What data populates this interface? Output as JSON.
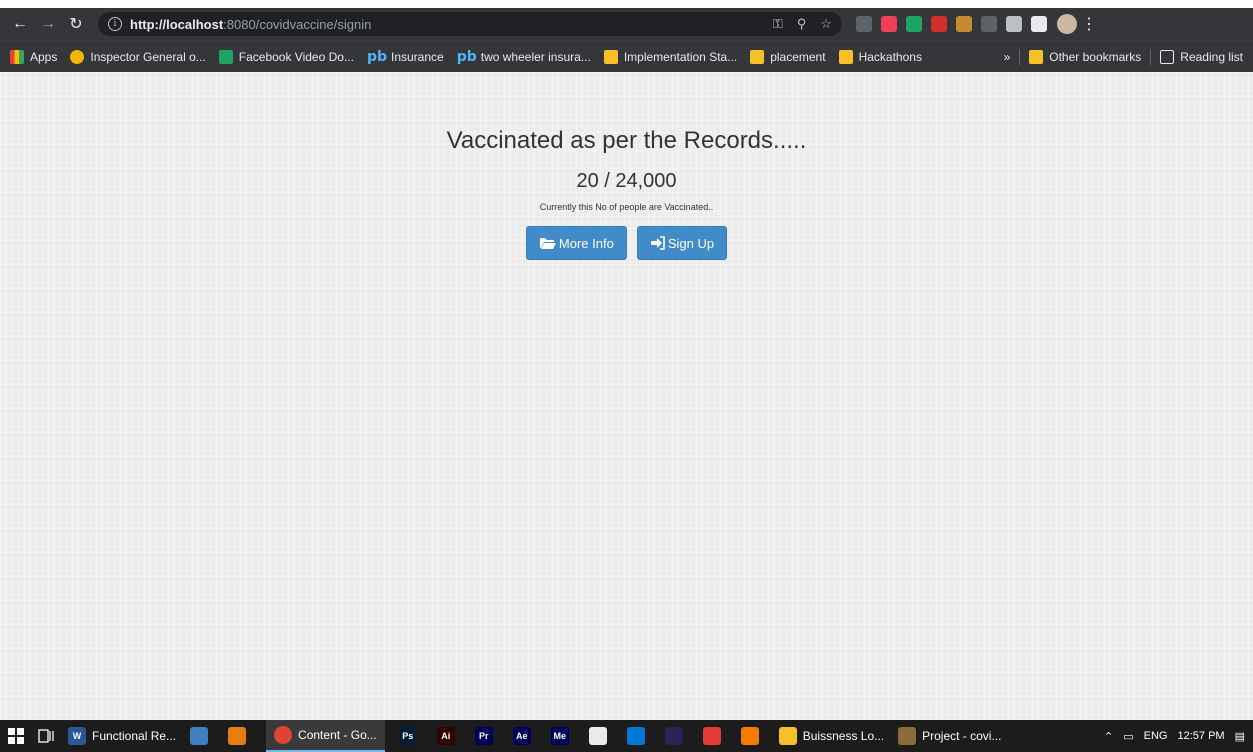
{
  "browser": {
    "url_host": "http://localhost",
    "url_rest": ":8080/covidvaccine/signin",
    "omni_icons": [
      "key-icon",
      "zoom-icon",
      "star-icon"
    ],
    "extensions": [
      {
        "name": "camera-extension-icon",
        "color": "#5f6368"
      },
      {
        "name": "pocket-extension-icon",
        "color": "#ef3f56"
      },
      {
        "name": "wallet-extension-icon",
        "color": "#1fa463"
      },
      {
        "name": "opera-extension-icon",
        "color": "#d32f2f"
      },
      {
        "name": "cookie-extension-icon",
        "color": "#c58a2b"
      },
      {
        "name": "search-extension-icon",
        "color": "#5f6368"
      },
      {
        "name": "box-extension-icon",
        "color": "#bdc1c6"
      },
      {
        "name": "puzzle-extension-icon",
        "color": "#e8eaed"
      }
    ]
  },
  "bookmarks": {
    "apps": "Apps",
    "items": [
      {
        "label": "Inspector General o...",
        "icon": "globe-icon",
        "color": "#f4b400"
      },
      {
        "label": "Facebook Video Do...",
        "icon": "download-icon",
        "color": "#1fa463"
      },
      {
        "label": "Insurance",
        "icon": "pb-icon",
        "color": ""
      },
      {
        "label": "two wheeler insura...",
        "icon": "pb-icon",
        "color": ""
      },
      {
        "label": "Implementation Sta...",
        "icon": "folder-icon",
        "color": "#f6c026"
      },
      {
        "label": "placement",
        "icon": "folder-icon",
        "color": "#f6c026"
      },
      {
        "label": "Hackathons",
        "icon": "folder-icon",
        "color": "#f6c026"
      }
    ],
    "overflow": "»",
    "other": "Other bookmarks",
    "reading": "Reading list"
  },
  "page": {
    "title": "Vaccinated as per the Records.....",
    "count": "20 / 24,000",
    "note": "Currently this No of people are Vaccinated..",
    "more_info": "More Info",
    "sign_up": "Sign Up"
  },
  "taskbar": {
    "items": [
      {
        "label": "Functional Re...",
        "icon": "word-icon",
        "color": "#2b579a",
        "glyph": "W",
        "active": false
      },
      {
        "label": "",
        "icon": "app-icon",
        "color": "#3f7fbf",
        "glyph": "",
        "active": false
      },
      {
        "label": "",
        "icon": "blender-icon",
        "color": "#e87d0d",
        "glyph": "",
        "active": false
      },
      {
        "label": "Content - Go...",
        "icon": "chrome-icon",
        "color": "#db4437",
        "glyph": "",
        "active": true
      },
      {
        "label": "",
        "icon": "photoshop-icon",
        "color": "#001e36",
        "glyph": "Ps",
        "active": false
      },
      {
        "label": "",
        "icon": "illustrator-icon",
        "color": "#330000",
        "glyph": "Ai",
        "active": false
      },
      {
        "label": "",
        "icon": "premiere-icon",
        "color": "#00005b",
        "glyph": "Pr",
        "active": false
      },
      {
        "label": "",
        "icon": "aftereffects-icon",
        "color": "#00005b",
        "glyph": "Ae",
        "active": false
      },
      {
        "label": "",
        "icon": "mediaencoder-icon",
        "color": "#00005b",
        "glyph": "Me",
        "active": false
      },
      {
        "label": "",
        "icon": "file-icon",
        "color": "#e8eaed",
        "glyph": "",
        "active": false
      },
      {
        "label": "",
        "icon": "vscode-icon",
        "color": "#0078d7",
        "glyph": "",
        "active": false
      },
      {
        "label": "",
        "icon": "eclipse-icon",
        "color": "#2c2255",
        "glyph": "",
        "active": false
      },
      {
        "label": "",
        "icon": "app-red-icon",
        "color": "#e53935",
        "glyph": "",
        "active": false
      },
      {
        "label": "",
        "icon": "app-orange-icon",
        "color": "#f57c00",
        "glyph": "",
        "active": false
      },
      {
        "label": "Buissness Lo...",
        "icon": "folder-icon",
        "color": "#f6c026",
        "glyph": "",
        "active": false
      },
      {
        "label": "Project - covi...",
        "icon": "project-icon",
        "color": "#8a6d3b",
        "glyph": "",
        "active": false
      }
    ],
    "lang": "ENG",
    "time": "12:57 PM"
  }
}
